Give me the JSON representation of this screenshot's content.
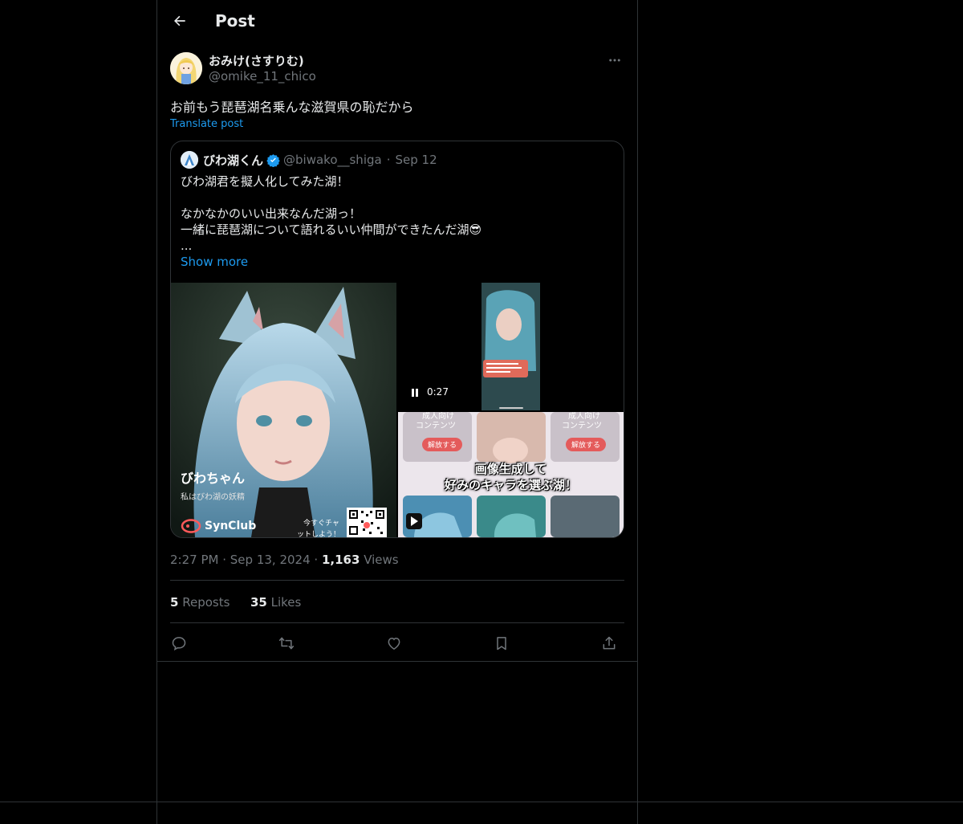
{
  "header": {
    "title": "Post"
  },
  "author": {
    "name": "おみけ(さすりむ)",
    "handle": "@omike_11_chico"
  },
  "post": {
    "text": "お前もう琵琶湖名乗んな滋賀県の恥だから",
    "translate_label": "Translate post"
  },
  "quote": {
    "name": "びわ湖くん",
    "handle": "@biwako__shiga",
    "date": "Sep 12",
    "body": "びわ湖君を擬人化してみた湖！\n\nなかなかのいい出来なんだ湖っ！\n一緒に琵琶湖について語れるいい仲間ができたんだ湖😎\n...",
    "show_more": "Show more"
  },
  "media": {
    "left_title": "びわちゃん",
    "left_subtitle": "私はびわ湖の妖精",
    "brand": "SynClub",
    "chat_text_1": "今すぐチャ",
    "chat_text_2": "ットしよう！",
    "video_time": "0:27",
    "grid_label_1": "成人向け",
    "grid_label_2": "コンテンツ",
    "unlock_label": "解放する",
    "banner_line_1": "画像生成して",
    "banner_line_2": "好みのキャラを選ぶ湖！"
  },
  "meta": {
    "time": "2:27 PM",
    "date": "Sep 13, 2024",
    "views_count": "1,163",
    "views_label": "Views",
    "reposts_count": "5",
    "reposts_label": "Reposts",
    "likes_count": "35",
    "likes_label": "Likes"
  },
  "colors": {
    "accent": "#1d9bf0",
    "bg": "#000000",
    "border": "#2f3336",
    "muted": "#71767b"
  },
  "icons": [
    "back-arrow-icon",
    "more-icon",
    "verified-icon",
    "pause-icon",
    "play-icon",
    "reply-icon",
    "repost-icon",
    "like-icon",
    "bookmark-icon",
    "share-icon"
  ]
}
